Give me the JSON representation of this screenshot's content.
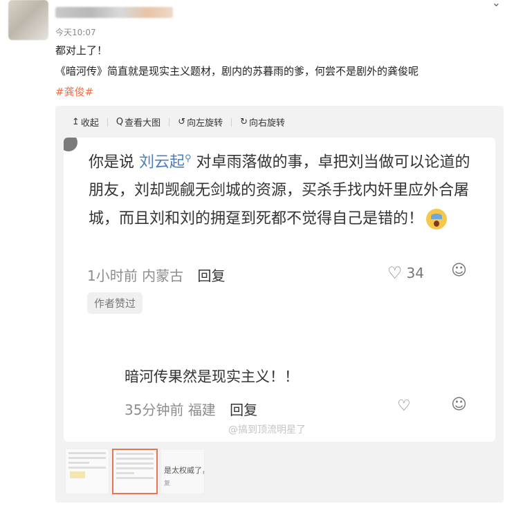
{
  "post": {
    "time": "今天10:07",
    "line1": "都对上了！",
    "line2": "《暗河传》简直就是现实主义题材，剧内的苏暮雨的爹，何尝不是剧外的龚俊呢",
    "hashtag": "#龚俊#"
  },
  "toolbar": {
    "collapse": "收起",
    "view_large": "查看大图",
    "rotate_left": "向左旋转",
    "rotate_right": "向右旋转"
  },
  "comment": {
    "prefix": "你是说 ",
    "mention": "刘云起",
    "body": " 对卓雨落做的事，卓把刘当做可以论道的朋友，刘却觊觎无剑城的资源，买杀手找内奸里应外合屠城，而且刘和刘的拥趸到死都不觉得自己是错的！",
    "time": "1小时前",
    "location": "内蒙古",
    "reply": "回复",
    "likes": "34",
    "author_badge": "作者赞过"
  },
  "subcomment": {
    "text": "暗河传果然是现实主义！！",
    "time": "35分钟前",
    "location": "福建",
    "reply": "回复"
  },
  "watermark": "@搞到顶流明星了",
  "thumb3_text": "是太权威了，",
  "thumb3_sub": "复",
  "icons": {
    "collapse": "collapse-up-icon",
    "zoom": "magnifier-icon",
    "rotate_left": "rotate-left-icon",
    "rotate_right": "rotate-right-icon",
    "like": "heart-icon",
    "more": "emoji-face-icon"
  },
  "colors": {
    "accent": "#eb7350",
    "mention": "#4a7fc1"
  }
}
